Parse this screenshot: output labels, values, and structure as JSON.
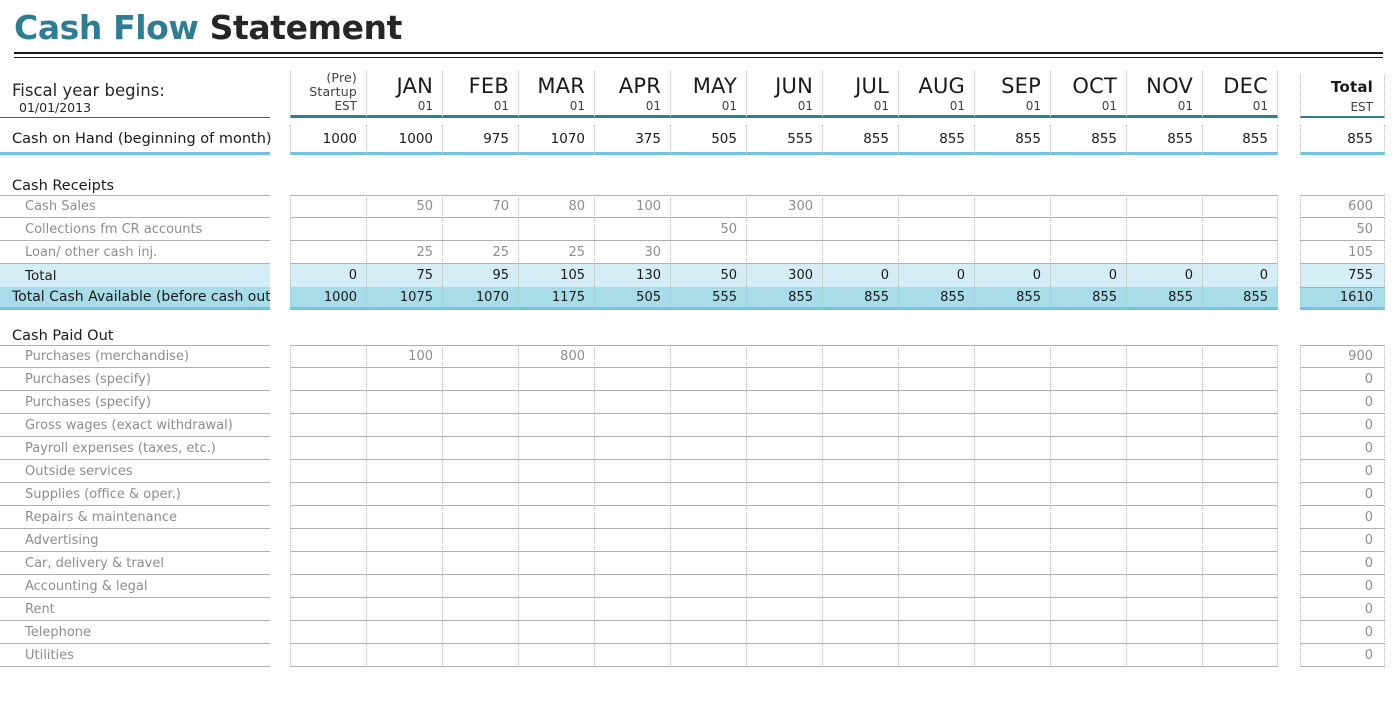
{
  "title": {
    "accent": "Cash Flow",
    "dark": "Statement"
  },
  "header": {
    "fiscal_label": "Fiscal year begins:",
    "fiscal_date": "01/01/2013",
    "columns": [
      {
        "name": "(Pre)",
        "name2": "Startup",
        "sub": "EST",
        "kind": "startup"
      },
      {
        "name": "JAN",
        "sub": "01",
        "kind": "month"
      },
      {
        "name": "FEB",
        "sub": "01",
        "kind": "month"
      },
      {
        "name": "MAR",
        "sub": "01",
        "kind": "month"
      },
      {
        "name": "APR",
        "sub": "01",
        "kind": "month"
      },
      {
        "name": "MAY",
        "sub": "01",
        "kind": "month"
      },
      {
        "name": "JUN",
        "sub": "01",
        "kind": "month"
      },
      {
        "name": "JUL",
        "sub": "01",
        "kind": "month"
      },
      {
        "name": "AUG",
        "sub": "01",
        "kind": "month"
      },
      {
        "name": "SEP",
        "sub": "01",
        "kind": "month"
      },
      {
        "name": "OCT",
        "sub": "01",
        "kind": "month"
      },
      {
        "name": "NOV",
        "sub": "01",
        "kind": "month"
      },
      {
        "name": "DEC",
        "sub": "01",
        "kind": "month"
      }
    ],
    "total_col": {
      "name": "Total",
      "sub": "EST"
    }
  },
  "cash_on_hand": {
    "label": "Cash on Hand (beginning of month)",
    "values": [
      "1000",
      "1000",
      "975",
      "1070",
      "375",
      "505",
      "555",
      "855",
      "855",
      "855",
      "855",
      "855",
      "855"
    ],
    "total": "855"
  },
  "cash_receipts": {
    "heading": "Cash Receipts",
    "rows": [
      {
        "label": "Cash Sales",
        "values": [
          "",
          "50",
          "70",
          "80",
          "100",
          "",
          "300",
          "",
          "",
          "",
          "",
          "",
          ""
        ],
        "total": "600"
      },
      {
        "label": "Collections fm CR accounts",
        "values": [
          "",
          "",
          "",
          "",
          "",
          "50",
          "",
          "",
          "",
          "",
          "",
          "",
          ""
        ],
        "total": "50"
      },
      {
        "label": "Loan/ other cash inj.",
        "values": [
          "",
          "25",
          "25",
          "25",
          "30",
          "",
          "",
          "",
          "",
          "",
          "",
          "",
          ""
        ],
        "total": "105"
      }
    ],
    "subtotal": {
      "label": "Total",
      "values": [
        "0",
        "75",
        "95",
        "105",
        "130",
        "50",
        "300",
        "0",
        "0",
        "0",
        "0",
        "0",
        "0"
      ],
      "total": "755"
    },
    "grand": {
      "label": "Total Cash Available (before cash out)",
      "values": [
        "1000",
        "1075",
        "1070",
        "1175",
        "505",
        "555",
        "855",
        "855",
        "855",
        "855",
        "855",
        "855",
        "855"
      ],
      "total": "1610"
    }
  },
  "cash_paid_out": {
    "heading": "Cash Paid Out",
    "rows": [
      {
        "label": "Purchases (merchandise)",
        "values": [
          "",
          "100",
          "",
          "800",
          "",
          "",
          "",
          "",
          "",
          "",
          "",
          "",
          ""
        ],
        "total": "900"
      },
      {
        "label": "Purchases (specify)",
        "values": [
          "",
          "",
          "",
          "",
          "",
          "",
          "",
          "",
          "",
          "",
          "",
          "",
          ""
        ],
        "total": "0"
      },
      {
        "label": "Purchases (specify)",
        "values": [
          "",
          "",
          "",
          "",
          "",
          "",
          "",
          "",
          "",
          "",
          "",
          "",
          ""
        ],
        "total": "0"
      },
      {
        "label": "Gross wages (exact withdrawal)",
        "values": [
          "",
          "",
          "",
          "",
          "",
          "",
          "",
          "",
          "",
          "",
          "",
          "",
          ""
        ],
        "total": "0"
      },
      {
        "label": "Payroll expenses (taxes, etc.)",
        "values": [
          "",
          "",
          "",
          "",
          "",
          "",
          "",
          "",
          "",
          "",
          "",
          "",
          ""
        ],
        "total": "0"
      },
      {
        "label": "Outside services",
        "values": [
          "",
          "",
          "",
          "",
          "",
          "",
          "",
          "",
          "",
          "",
          "",
          "",
          ""
        ],
        "total": "0"
      },
      {
        "label": "Supplies (office & oper.)",
        "values": [
          "",
          "",
          "",
          "",
          "",
          "",
          "",
          "",
          "",
          "",
          "",
          "",
          ""
        ],
        "total": "0"
      },
      {
        "label": "Repairs & maintenance",
        "values": [
          "",
          "",
          "",
          "",
          "",
          "",
          "",
          "",
          "",
          "",
          "",
          "",
          ""
        ],
        "total": "0"
      },
      {
        "label": "Advertising",
        "values": [
          "",
          "",
          "",
          "",
          "",
          "",
          "",
          "",
          "",
          "",
          "",
          "",
          ""
        ],
        "total": "0"
      },
      {
        "label": "Car, delivery & travel",
        "values": [
          "",
          "",
          "",
          "",
          "",
          "",
          "",
          "",
          "",
          "",
          "",
          "",
          ""
        ],
        "total": "0"
      },
      {
        "label": "Accounting & legal",
        "values": [
          "",
          "",
          "",
          "",
          "",
          "",
          "",
          "",
          "",
          "",
          "",
          "",
          ""
        ],
        "total": "0"
      },
      {
        "label": "Rent",
        "values": [
          "",
          "",
          "",
          "",
          "",
          "",
          "",
          "",
          "",
          "",
          "",
          "",
          ""
        ],
        "total": "0"
      },
      {
        "label": "Telephone",
        "values": [
          "",
          "",
          "",
          "",
          "",
          "",
          "",
          "",
          "",
          "",
          "",
          "",
          ""
        ],
        "total": "0"
      },
      {
        "label": "Utilities",
        "values": [
          "",
          "",
          "",
          "",
          "",
          "",
          "",
          "",
          "",
          "",
          "",
          "",
          ""
        ],
        "total": "0"
      }
    ]
  },
  "colors": {
    "accent": "#2d7e93",
    "rule": "#6fc5dc",
    "subtotal_bg": "#d5eef5",
    "grandtotal_bg": "#a8dce8"
  }
}
